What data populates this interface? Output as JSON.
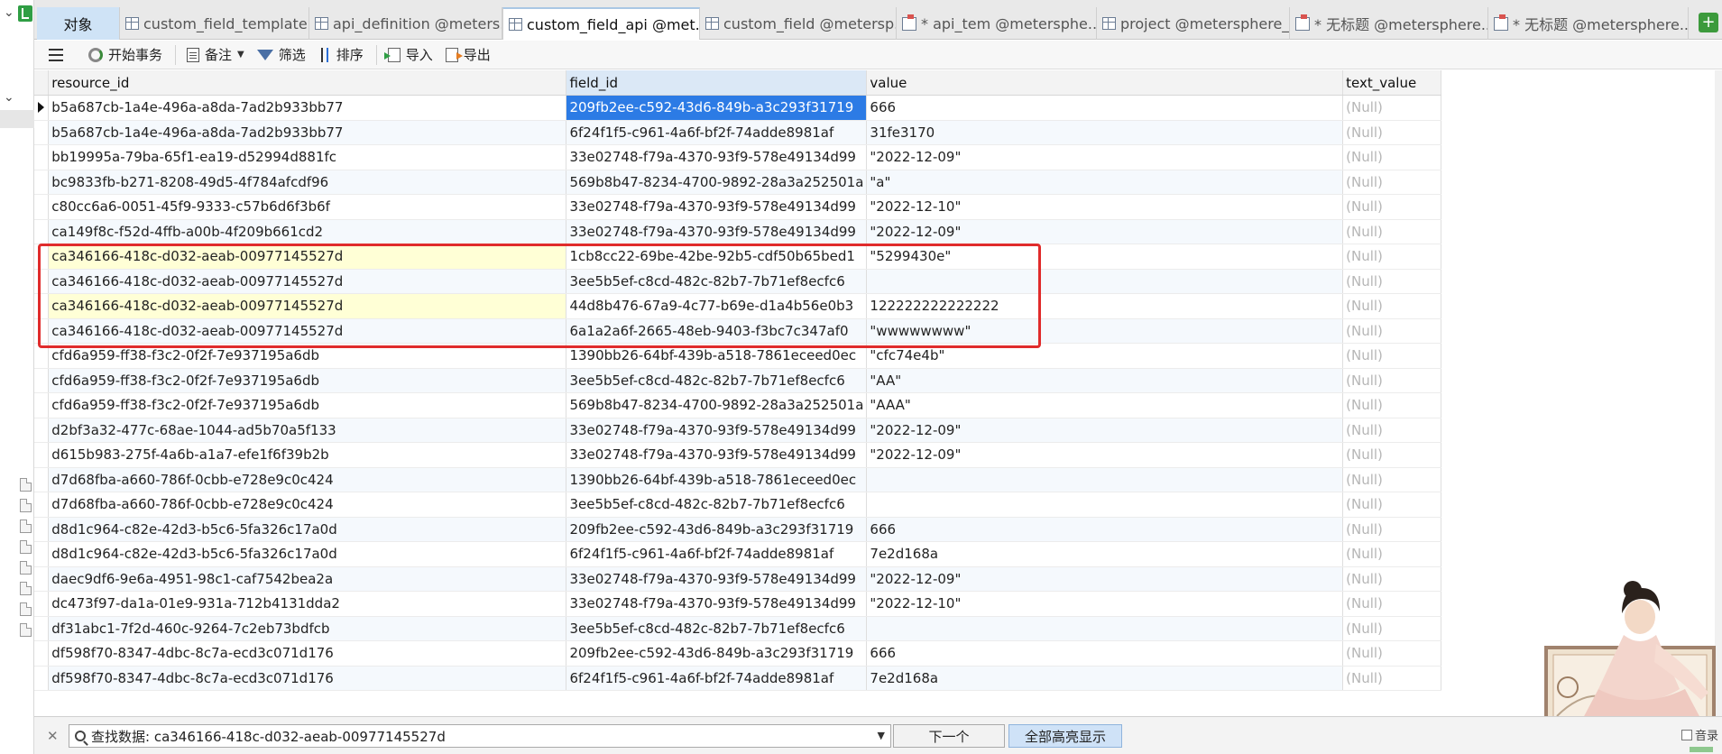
{
  "tabs": [
    {
      "label": "对象",
      "type": "object"
    },
    {
      "label": "custom_field_template ...",
      "type": "table"
    },
    {
      "label": "api_definition @meters...",
      "type": "table"
    },
    {
      "label": "custom_field_api @met...",
      "type": "table",
      "active": true
    },
    {
      "label": "custom_field @metersp...",
      "type": "table"
    },
    {
      "label": "* api_tem @metersphe...",
      "type": "query"
    },
    {
      "label": "project @metersphere_...",
      "type": "table"
    },
    {
      "label": "* 无标题 @metersphere...",
      "type": "query"
    },
    {
      "label": "* 无标题 @metersphere...",
      "type": "query"
    }
  ],
  "toolbar": {
    "begin_tx": "开始事务",
    "note": "备注",
    "filter": "筛选",
    "sort": "排序",
    "import": "导入",
    "export": "导出"
  },
  "grid": {
    "columns": [
      "resource_id",
      "field_id",
      "value",
      "text_value"
    ],
    "rows": [
      [
        "b5a687cb-1a4e-496a-a8da-7ad2b933bb77",
        "209fb2ee-c592-43d6-849b-a3c293f31719",
        "666",
        "(Null)"
      ],
      [
        "b5a687cb-1a4e-496a-a8da-7ad2b933bb77",
        "6f24f1f5-c961-4a6f-bf2f-74adde8981af",
        "31fe3170",
        "(Null)"
      ],
      [
        "bb19995a-79ba-65f1-ea19-d52994d881fc",
        "33e02748-f79a-4370-93f9-578e49134d99",
        "\"2022-12-09\"",
        "(Null)"
      ],
      [
        "bc9833fb-b271-8208-49d5-4f784afcdf96",
        "569b8b47-8234-4700-9892-28a3a252501a",
        "\"a\"",
        "(Null)"
      ],
      [
        "c80cc6a6-0051-45f9-9333-c57b6d6f3b6f",
        "33e02748-f79a-4370-93f9-578e49134d99",
        "\"2022-12-10\"",
        "(Null)"
      ],
      [
        "ca149f8c-f52d-4ffb-a00b-4f209b661cd2",
        "33e02748-f79a-4370-93f9-578e49134d99",
        "\"2022-12-09\"",
        "(Null)"
      ],
      [
        "ca346166-418c-d032-aeab-00977145527d",
        "1cb8cc22-69be-42be-92b5-cdf50b65bed1",
        "\"5299430e\"",
        "(Null)"
      ],
      [
        "ca346166-418c-d032-aeab-00977145527d",
        "3ee5b5ef-c8cd-482c-82b7-7b71ef8ecfc6",
        "",
        "(Null)"
      ],
      [
        "ca346166-418c-d032-aeab-00977145527d",
        "44d8b476-67a9-4c77-b69e-d1a4b56e0b3",
        "122222222222222",
        "(Null)"
      ],
      [
        "ca346166-418c-d032-aeab-00977145527d",
        "6a1a2a6f-2665-48eb-9403-f3bc7c347af0",
        "\"wwwwwwww\"",
        "(Null)"
      ],
      [
        "cfd6a959-ff38-f3c2-0f2f-7e937195a6db",
        "1390bb26-64bf-439b-a518-7861eceed0ec",
        "\"cfc74e4b\"",
        "(Null)"
      ],
      [
        "cfd6a959-ff38-f3c2-0f2f-7e937195a6db",
        "3ee5b5ef-c8cd-482c-82b7-7b71ef8ecfc6",
        "\"AA\"",
        "(Null)"
      ],
      [
        "cfd6a959-ff38-f3c2-0f2f-7e937195a6db",
        "569b8b47-8234-4700-9892-28a3a252501a",
        "\"AAA\"",
        "(Null)"
      ],
      [
        "d2bf3a32-477c-68ae-1044-ad5b70a5f133",
        "33e02748-f79a-4370-93f9-578e49134d99",
        "\"2022-12-09\"",
        "(Null)"
      ],
      [
        "d615b983-275f-4a6b-a1a7-efe1f6f39b2b",
        "33e02748-f79a-4370-93f9-578e49134d99",
        "\"2022-12-09\"",
        "(Null)"
      ],
      [
        "d7d68fba-a660-786f-0cbb-e728e9c0c424",
        "1390bb26-64bf-439b-a518-7861eceed0ec",
        "",
        "(Null)"
      ],
      [
        "d7d68fba-a660-786f-0cbb-e728e9c0c424",
        "3ee5b5ef-c8cd-482c-82b7-7b71ef8ecfc6",
        "",
        "(Null)"
      ],
      [
        "d8d1c964-c82e-42d3-b5c6-5fa326c17a0d",
        "209fb2ee-c592-43d6-849b-a3c293f31719",
        "666",
        "(Null)"
      ],
      [
        "d8d1c964-c82e-42d3-b5c6-5fa326c17a0d",
        "6f24f1f5-c961-4a6f-bf2f-74adde8981af",
        "7e2d168a",
        "(Null)"
      ],
      [
        "daec9df6-9e6a-4951-98c1-caf7542bea2a",
        "33e02748-f79a-4370-93f9-578e49134d99",
        "\"2022-12-09\"",
        "(Null)"
      ],
      [
        "dc473f97-da1a-01e9-931a-712b4131dda2",
        "33e02748-f79a-4370-93f9-578e49134d99",
        "\"2022-12-10\"",
        "(Null)"
      ],
      [
        "df31abc1-7f2d-460c-9264-7c2eb73bdfcb",
        "3ee5b5ef-c8cd-482c-82b7-7b71ef8ecfc6",
        "",
        "(Null)"
      ],
      [
        "df598f70-8347-4dbc-8c7a-ecd3c071d176",
        "209fb2ee-c592-43d6-849b-a3c293f31719",
        "666",
        "(Null)"
      ],
      [
        "df598f70-8347-4dbc-8c7a-ecd3c071d176",
        "6f24f1f5-c961-4a6f-bf2f-74adde8981af",
        "7e2d168a",
        "(Null)"
      ]
    ]
  },
  "findbar": {
    "query": "查找数据: ca346166-418c-d032-aeab-00977145527d",
    "next_label": "下一个",
    "highlight_all_label": "全部高亮显示",
    "checkbox_label": "音录"
  },
  "colors": {
    "selection_blue": "#2c7be5",
    "match_highlight": "#ffffd6",
    "annotation_red": "#e02b2b",
    "active_tab_tint": "#cfe3f6"
  }
}
